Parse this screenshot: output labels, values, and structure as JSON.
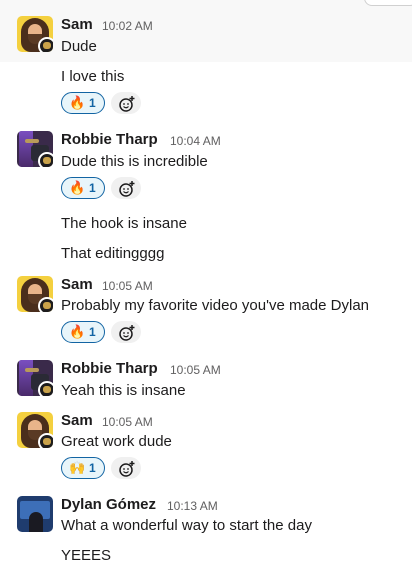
{
  "messages": [
    {
      "sender": "Sam",
      "time": "10:02 AM",
      "lines": [
        "Dude"
      ]
    },
    {
      "lines": [
        "I love this"
      ],
      "reaction": {
        "emoji": "🔥",
        "count": "1"
      }
    },
    {
      "sender": "Robbie Tharp",
      "time": "10:04 AM",
      "lines": [
        "Dude this is incredible"
      ],
      "reaction": {
        "emoji": "🔥",
        "count": "1"
      }
    },
    {
      "lines": [
        "The hook is insane"
      ]
    },
    {
      "lines": [
        "That editingggg"
      ]
    },
    {
      "sender": "Sam",
      "time": "10:05 AM",
      "lines": [
        "Probably my favorite video you've made Dylan"
      ],
      "reaction": {
        "emoji": "🔥",
        "count": "1"
      }
    },
    {
      "sender": "Robbie Tharp",
      "time": "10:05 AM",
      "lines": [
        "Yeah this is insane"
      ]
    },
    {
      "sender": "Sam",
      "time": "10:05 AM",
      "lines": [
        "Great work dude"
      ],
      "reaction": {
        "emoji": "🙌",
        "count": "1"
      }
    },
    {
      "sender": "Dylan Gómez",
      "time": "10:13 AM",
      "lines": [
        "What a wonderful way to start the day"
      ]
    },
    {
      "lines": [
        "YEEES"
      ]
    }
  ],
  "icons": {
    "add_reaction": "add-reaction-icon",
    "avatar_badge": "status-badge-icon"
  },
  "colors": {
    "reaction_border": "#1264a3",
    "reaction_bg": "#e8f5fa",
    "hover_bg": "#f8f8f8"
  }
}
